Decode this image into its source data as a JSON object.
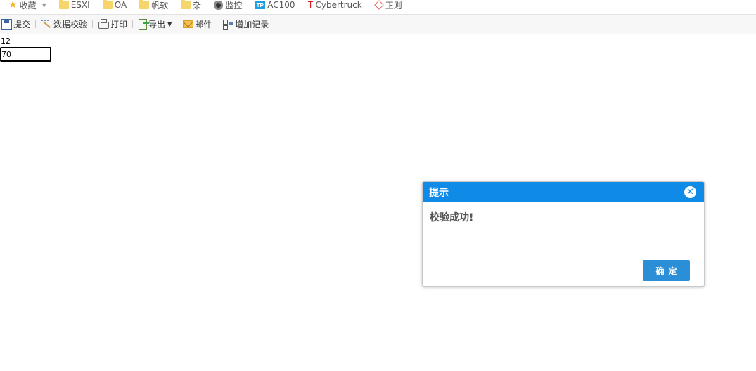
{
  "bookmarks": [
    {
      "label": "收藏",
      "icon": "star-icon"
    },
    {
      "label": "ESXI",
      "icon": "folder-icon"
    },
    {
      "label": "OA",
      "icon": "folder-icon"
    },
    {
      "label": "帆软",
      "icon": "folder-icon"
    },
    {
      "label": "杂",
      "icon": "folder-icon"
    },
    {
      "label": "监控",
      "icon": "camera-icon"
    },
    {
      "label": "AC100",
      "icon": "tp-link-icon",
      "icon_text": "TP"
    },
    {
      "label": "Cybertruck",
      "icon": "tesla-icon",
      "icon_text": "T"
    },
    {
      "label": "正则",
      "icon": "cube-icon"
    }
  ],
  "toolbar": {
    "submit": "提交",
    "validate": "数据校验",
    "print": "打印",
    "export": "导出",
    "mail": "邮件",
    "add_record": "增加记录"
  },
  "form": {
    "label": "12",
    "value": "70"
  },
  "dialog": {
    "title": "提示",
    "message": "校验成功!",
    "ok_label": "确定",
    "header_color": "#0f8ae6",
    "button_color": "#2a8fd6"
  }
}
